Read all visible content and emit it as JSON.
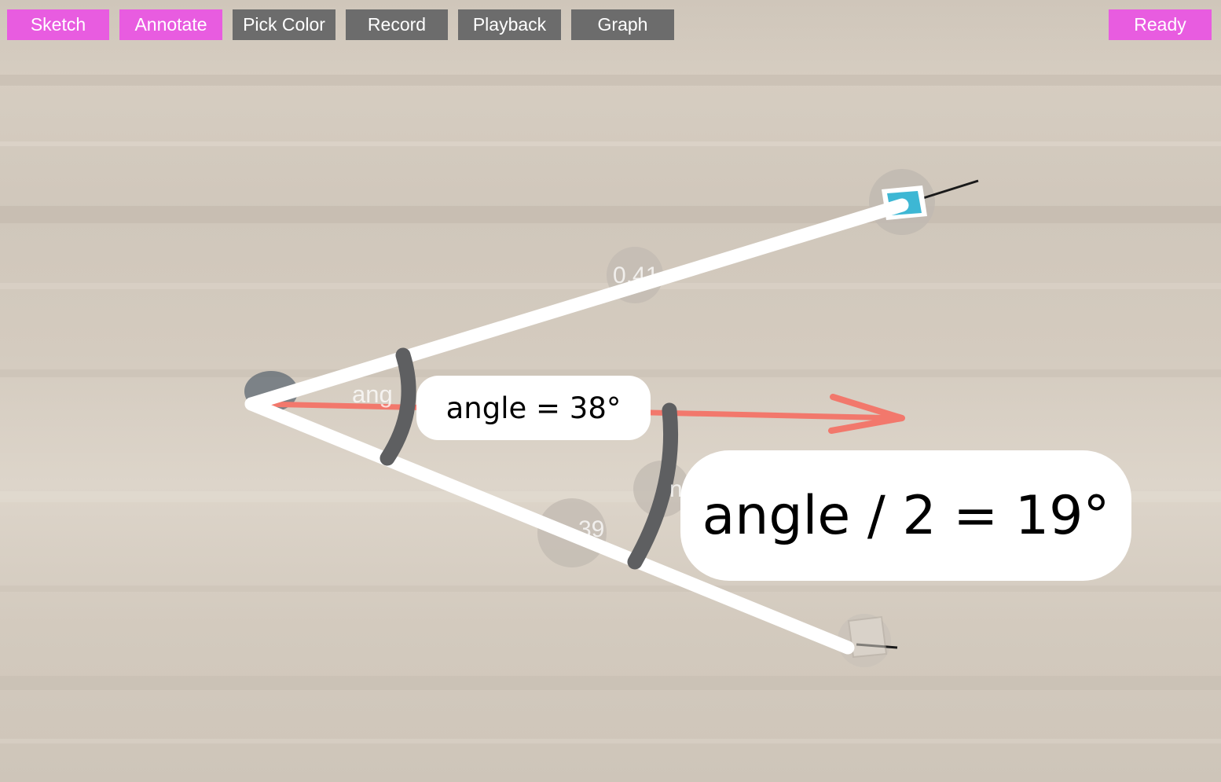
{
  "toolbar": {
    "sketch": "Sketch",
    "annotate": "Annotate",
    "pick_color": "Pick Color",
    "record": "Record",
    "playback": "Playback",
    "graph": "Graph"
  },
  "status": {
    "ready": "Ready"
  },
  "labels": {
    "angle": "angle = 38°",
    "half_angle": "angle / 2 = 19°"
  },
  "ghost": {
    "angle_partial": "ang",
    "upper_partial": "0.41",
    "lower_partial": "39",
    "n_partial": "n"
  },
  "colors": {
    "toolbar_active": "#e85ce0",
    "toolbar_inactive": "#6c6c6c",
    "rays": "#ffffff",
    "arcs": "#5e5f61",
    "arrow": "#f2786c"
  },
  "icons": {
    "marker_top": "cyan-square-marker",
    "marker_bottom": "faded-square-marker"
  }
}
